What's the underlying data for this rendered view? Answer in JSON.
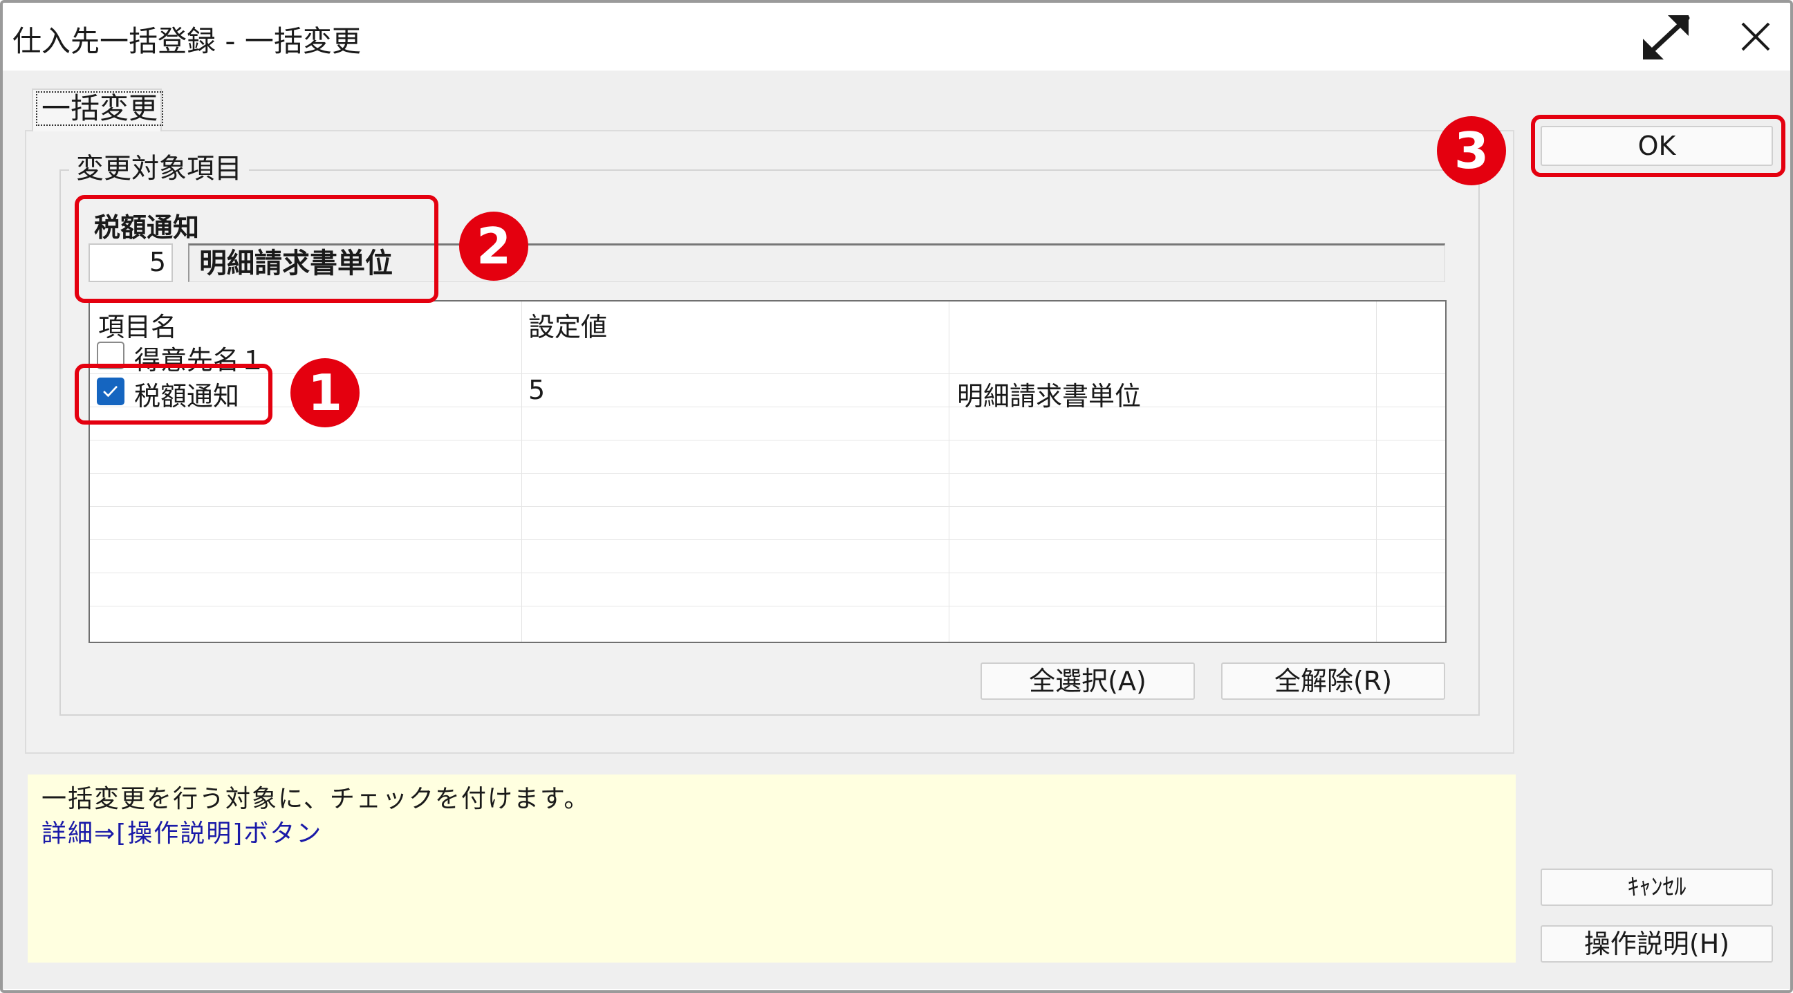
{
  "window": {
    "title": "仕入先一括登録 - 一括変更",
    "expand_icon": "expand-arrows-icon",
    "close_icon": "close-icon"
  },
  "tab": {
    "label": "一括変更"
  },
  "group": {
    "legend": "変更対象項目"
  },
  "field": {
    "label": "税額通知",
    "code": "5",
    "value": "明細請求書単位"
  },
  "table": {
    "headers": [
      "項目名",
      "設定値",
      ""
    ],
    "rows": [
      {
        "checked": false,
        "name": "得意先名１",
        "value": "",
        "desc": ""
      },
      {
        "checked": true,
        "name": "税額通知",
        "value": "5",
        "desc": "明細請求書単位"
      }
    ]
  },
  "buttons": {
    "select_all": "全選択(A)",
    "deselect_all": "全解除(R)",
    "ok": "OK",
    "cancel": "ｷｬﾝｾﾙ",
    "help": "操作説明(H)"
  },
  "help": {
    "line1": "一括変更を行う対象に、チェックを付けます。",
    "line2": "詳細⇒[操作説明]ボタン"
  },
  "annotations": {
    "n1": "1",
    "n2": "2",
    "n3": "3",
    "color": "#e4000f"
  },
  "colors": {
    "checkbox": "#1565c0",
    "help_bg": "#ffffe0",
    "help_link": "#1a1aa8"
  }
}
